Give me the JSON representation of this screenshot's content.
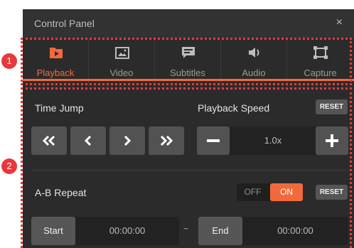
{
  "window": {
    "title": "Control Panel",
    "close_glyph": "×"
  },
  "tabs": [
    {
      "label": "Playback",
      "icon": "play-icon",
      "active": true
    },
    {
      "label": "Video",
      "icon": "image-icon",
      "active": false
    },
    {
      "label": "Subtitles",
      "icon": "subtitles-icon",
      "active": false
    },
    {
      "label": "Audio",
      "icon": "speaker-icon",
      "active": false
    },
    {
      "label": "Capture",
      "icon": "capture-frame-icon",
      "active": false
    }
  ],
  "time_jump": {
    "label": "Time Jump",
    "buttons": [
      "rewind-far-icon",
      "rewind-icon",
      "forward-icon",
      "forward-far-icon"
    ]
  },
  "playback_speed": {
    "label": "Playback Speed",
    "reset_label": "RESET",
    "value": "1.0x"
  },
  "ab_repeat": {
    "label": "A-B Repeat",
    "toggle_off": "OFF",
    "toggle_on": "ON",
    "reset_label": "RESET",
    "start_label": "Start",
    "start_time": "00:00:00",
    "separator": "~",
    "end_label": "End",
    "end_time": "00:00:00"
  },
  "annotations": {
    "marker_1": "1",
    "marker_2": "2"
  },
  "colors": {
    "accent": "#f26a3c",
    "marker": "#e8383a",
    "panel_bg": "#2b2b2b"
  }
}
